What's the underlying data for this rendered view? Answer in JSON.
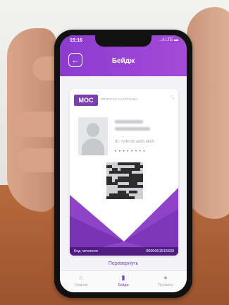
{
  "status": {
    "time": "15:16",
    "icons": "..ıl LTE ▬"
  },
  "header": {
    "title": "Бейдж",
    "back_icon": "back-arrow-icon"
  },
  "card": {
    "logo": "МОС",
    "subtitle": "ПРОПУСК УЧАСТНИКА",
    "id_text": "ID: 7240 00 a065 4605",
    "dots": "• • • • • • • •",
    "reader_label": "Код читателя",
    "reader_value": "0000001515630"
  },
  "flip_label": "Перевернуть",
  "tabs": [
    {
      "label": "Главная",
      "icon": "home-icon"
    },
    {
      "label": "Бейдж",
      "icon": "badge-icon"
    },
    {
      "label": "Профиль",
      "icon": "profile-icon"
    }
  ],
  "colors": {
    "accent": "#8b3ccf",
    "wedge": "#8e43c9",
    "wedge_dark": "#6a2aa8"
  }
}
